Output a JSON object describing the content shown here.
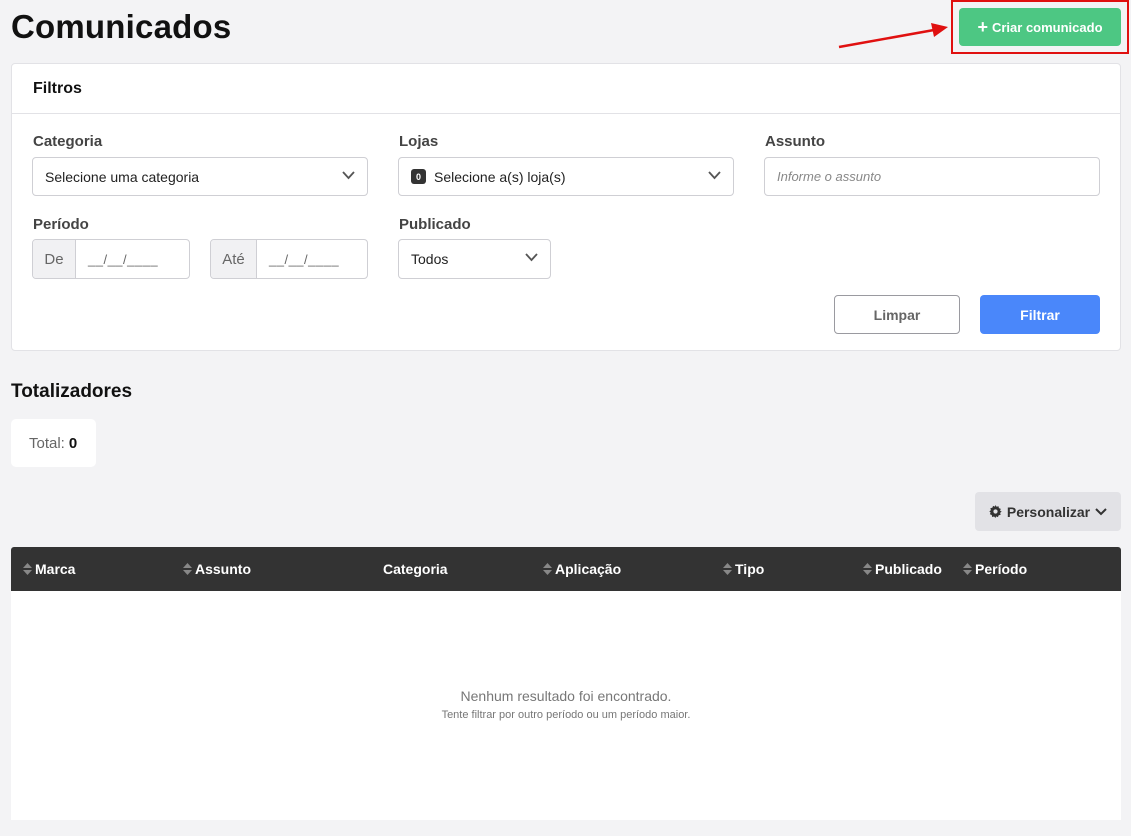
{
  "header": {
    "title": "Comunicados",
    "create_button": {
      "icon": "plus-icon",
      "label": "Criar comunicado",
      "color": "#4dc783"
    },
    "annotation": {
      "highlight_color": "#e01010"
    }
  },
  "filters": {
    "title": "Filtros",
    "category": {
      "label": "Categoria",
      "value": "Selecione uma categoria"
    },
    "stores": {
      "label": "Lojas",
      "badge": "0",
      "value": "Selecione a(s) loja(s)"
    },
    "subject": {
      "label": "Assunto",
      "placeholder": "Informe o assunto"
    },
    "period": {
      "label": "Período",
      "from_prefix": "De",
      "from_mask": "__/__/____",
      "to_prefix": "Até",
      "to_mask": "__/__/____"
    },
    "published": {
      "label": "Publicado",
      "value": "Todos"
    },
    "clear_label": "Limpar",
    "filter_label": "Filtrar",
    "filter_color": "#4a87fa"
  },
  "totals": {
    "title": "Totalizadores",
    "total_label": "Total:",
    "total_value": "0"
  },
  "table": {
    "customize_label": "Personalizar",
    "columns": [
      {
        "label": "Marca",
        "sortable": true
      },
      {
        "label": "Assunto",
        "sortable": true
      },
      {
        "label": "Categoria",
        "sortable": false
      },
      {
        "label": "Aplicação",
        "sortable": true
      },
      {
        "label": "Tipo",
        "sortable": true
      },
      {
        "label": "Publicado",
        "sortable": true
      },
      {
        "label": "Período",
        "sortable": true
      }
    ],
    "empty_title": "Nenhum resultado foi encontrado.",
    "empty_subtitle": "Tente filtrar por outro período ou um período maior."
  }
}
